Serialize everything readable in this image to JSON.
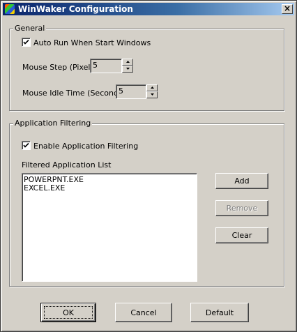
{
  "window": {
    "title": "WinWaker Configuration",
    "close_glyph": "×"
  },
  "general": {
    "group_title": "General",
    "auto_run": {
      "label": "Auto Run When Start Windows",
      "checked": true
    },
    "mouse_step": {
      "label": "Mouse Step (Pixel)",
      "value": "5"
    },
    "mouse_idle": {
      "label": "Mouse Idle Time  (Second)",
      "value": "5"
    }
  },
  "filtering": {
    "group_title": "Application Filtering",
    "enable": {
      "label": "Enable Application Filtering",
      "checked": true
    },
    "list_label": "Filtered Application List",
    "items": [
      "POWERPNT.EXE",
      "EXCEL.EXE"
    ],
    "add_label": "Add",
    "remove_label": "Remove",
    "clear_label": "Clear"
  },
  "footer": {
    "ok_label": "OK",
    "cancel_label": "Cancel",
    "default_label": "Default"
  },
  "icons": {
    "app": "winwaker-app-icon",
    "close": "close-icon",
    "check": "checkmark-icon",
    "spin_up": "spin-up-arrow-icon",
    "spin_down": "spin-down-arrow-icon"
  },
  "colors": {
    "face": "#d4d0c8",
    "title_start": "#0a246a",
    "title_end": "#a6caf0",
    "disabled_text": "#808080"
  }
}
